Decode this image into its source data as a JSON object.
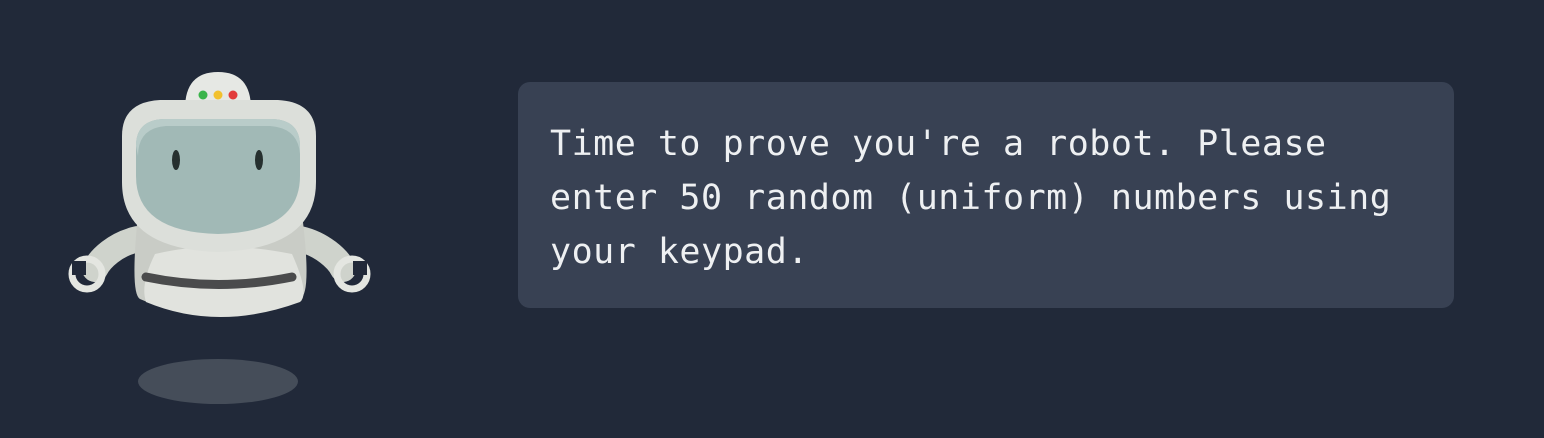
{
  "prompt": {
    "message": "Time to prove you're a robot. Please enter 50 random (uniform) numbers using your keypad."
  },
  "mascot": {
    "icon": "robot-mascot-icon",
    "indicator_lights": [
      "#3ab44a",
      "#f2c12e",
      "#e23b3b"
    ]
  },
  "colors": {
    "background": "#212939",
    "bubble": "#384153",
    "text": "#eef0f2"
  }
}
